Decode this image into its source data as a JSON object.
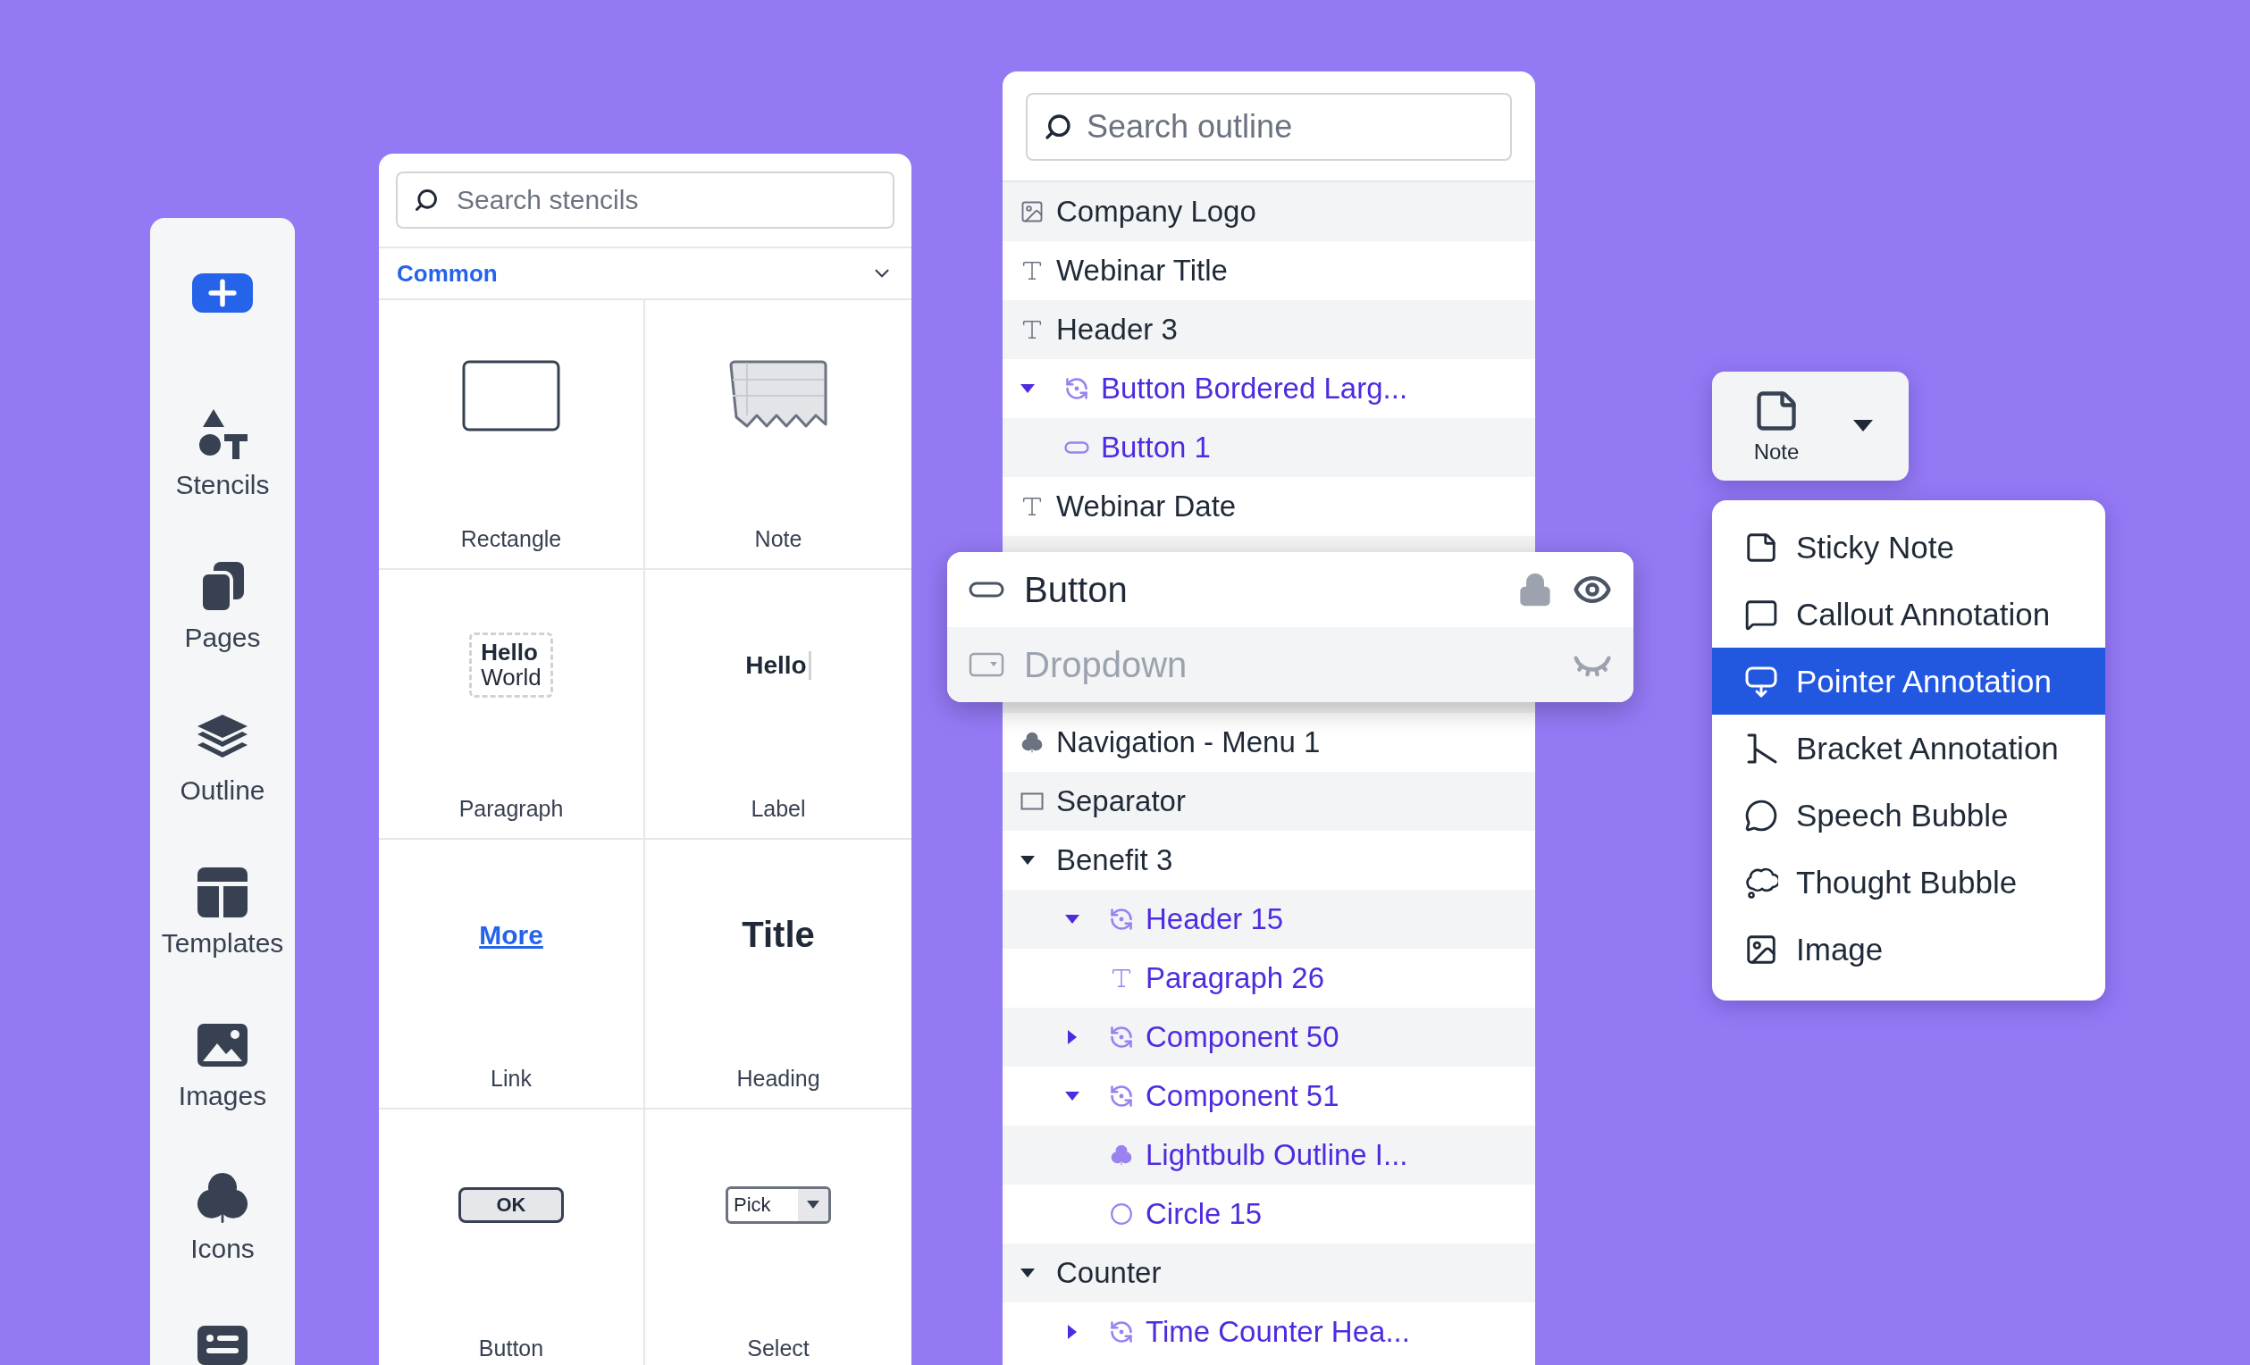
{
  "sidebar": {
    "items": [
      {
        "kind": "add",
        "selected": false
      },
      {
        "kind": "stencils",
        "label": "Stencils"
      },
      {
        "kind": "pages",
        "label": "Pages"
      },
      {
        "kind": "outline",
        "label": "Outline"
      },
      {
        "kind": "templates",
        "label": "Templates"
      },
      {
        "kind": "images",
        "label": "Images"
      },
      {
        "kind": "icons",
        "label": "Icons"
      },
      {
        "kind": "comments"
      }
    ]
  },
  "stencils": {
    "search": {
      "placeholder": "Search stencils"
    },
    "section": {
      "title": "Common",
      "expanded": true
    },
    "items": [
      {
        "kind": "rectangle",
        "name": "Rectangle"
      },
      {
        "kind": "note",
        "name": "Note"
      },
      {
        "kind": "paragraph",
        "name": "Paragraph",
        "preview": [
          "Hello",
          "World"
        ]
      },
      {
        "kind": "label",
        "name": "Label",
        "preview": [
          "Hello"
        ]
      },
      {
        "kind": "link",
        "name": "Link",
        "preview": [
          "More"
        ]
      },
      {
        "kind": "heading",
        "name": "Heading",
        "preview": [
          "Title"
        ]
      },
      {
        "kind": "button",
        "name": "Button",
        "preview": [
          "OK"
        ]
      },
      {
        "kind": "select",
        "name": "Select",
        "preview": [
          "Pick"
        ]
      }
    ]
  },
  "outline": {
    "search": {
      "placeholder": "Search outline"
    },
    "items": [
      {
        "label": "Company Logo",
        "kind": "image",
        "instance": false
      },
      {
        "label": "Webinar Title",
        "kind": "text",
        "instance": false
      },
      {
        "label": "Header 3",
        "kind": "text",
        "instance": false
      },
      {
        "label": "Button Bordered Larg...",
        "kind": "component",
        "instance": true,
        "expanded": true,
        "children": [
          {
            "label": "Button 1",
            "kind": "button",
            "instance": true
          }
        ]
      },
      {
        "label": "Webinar Date",
        "kind": "text",
        "instance": false
      },
      {
        "kind": "hidden"
      },
      {
        "kind": "hidden"
      },
      {
        "kind": "hidden"
      },
      {
        "label": "Navigation - Menu 1",
        "kind": "icon",
        "instance": false
      },
      {
        "label": "Separator",
        "kind": "rectangle",
        "instance": false
      },
      {
        "label": "Benefit 3",
        "kind": "group",
        "instance": false,
        "expanded": true,
        "children": [
          {
            "label": "Header 15",
            "kind": "component",
            "instance": true,
            "expanded": true,
            "children": [
              {
                "label": "Paragraph 26",
                "kind": "text",
                "instance": true
              }
            ]
          },
          {
            "label": "Component 50",
            "kind": "component",
            "instance": true,
            "expanded": false
          },
          {
            "label": "Component 51",
            "kind": "component",
            "instance": true,
            "expanded": true,
            "children": [
              {
                "label": "Lightbulb Outline I...",
                "kind": "icon",
                "instance": true
              },
              {
                "label": "Circle 15",
                "kind": "circle",
                "instance": true
              }
            ]
          }
        ]
      },
      {
        "label": "Counter",
        "kind": "group",
        "instance": false,
        "expanded": true,
        "children": [
          {
            "label": "Time Counter Hea...",
            "kind": "component",
            "instance": true,
            "expanded": false
          }
        ]
      }
    ]
  },
  "layer_popup": {
    "rows": [
      {
        "label": "Button",
        "kind": "button",
        "locked": true,
        "visible": true
      },
      {
        "label": "Dropdown",
        "kind": "dropdown",
        "locked": false,
        "visible": false
      }
    ]
  },
  "note_button": {
    "label": "Note"
  },
  "note_menu": {
    "items": [
      {
        "kind": "sticky",
        "label": "Sticky Note",
        "selected": false
      },
      {
        "kind": "callout",
        "label": "Callout Annotation",
        "selected": false
      },
      {
        "kind": "pointer",
        "label": "Pointer Annotation",
        "selected": true
      },
      {
        "kind": "bracket",
        "label": "Bracket Annotation",
        "selected": false
      },
      {
        "kind": "speech",
        "label": "Speech Bubble",
        "selected": false
      },
      {
        "kind": "thought",
        "label": "Thought Bubble",
        "selected": false
      },
      {
        "kind": "image",
        "label": "Image",
        "selected": false
      }
    ]
  }
}
